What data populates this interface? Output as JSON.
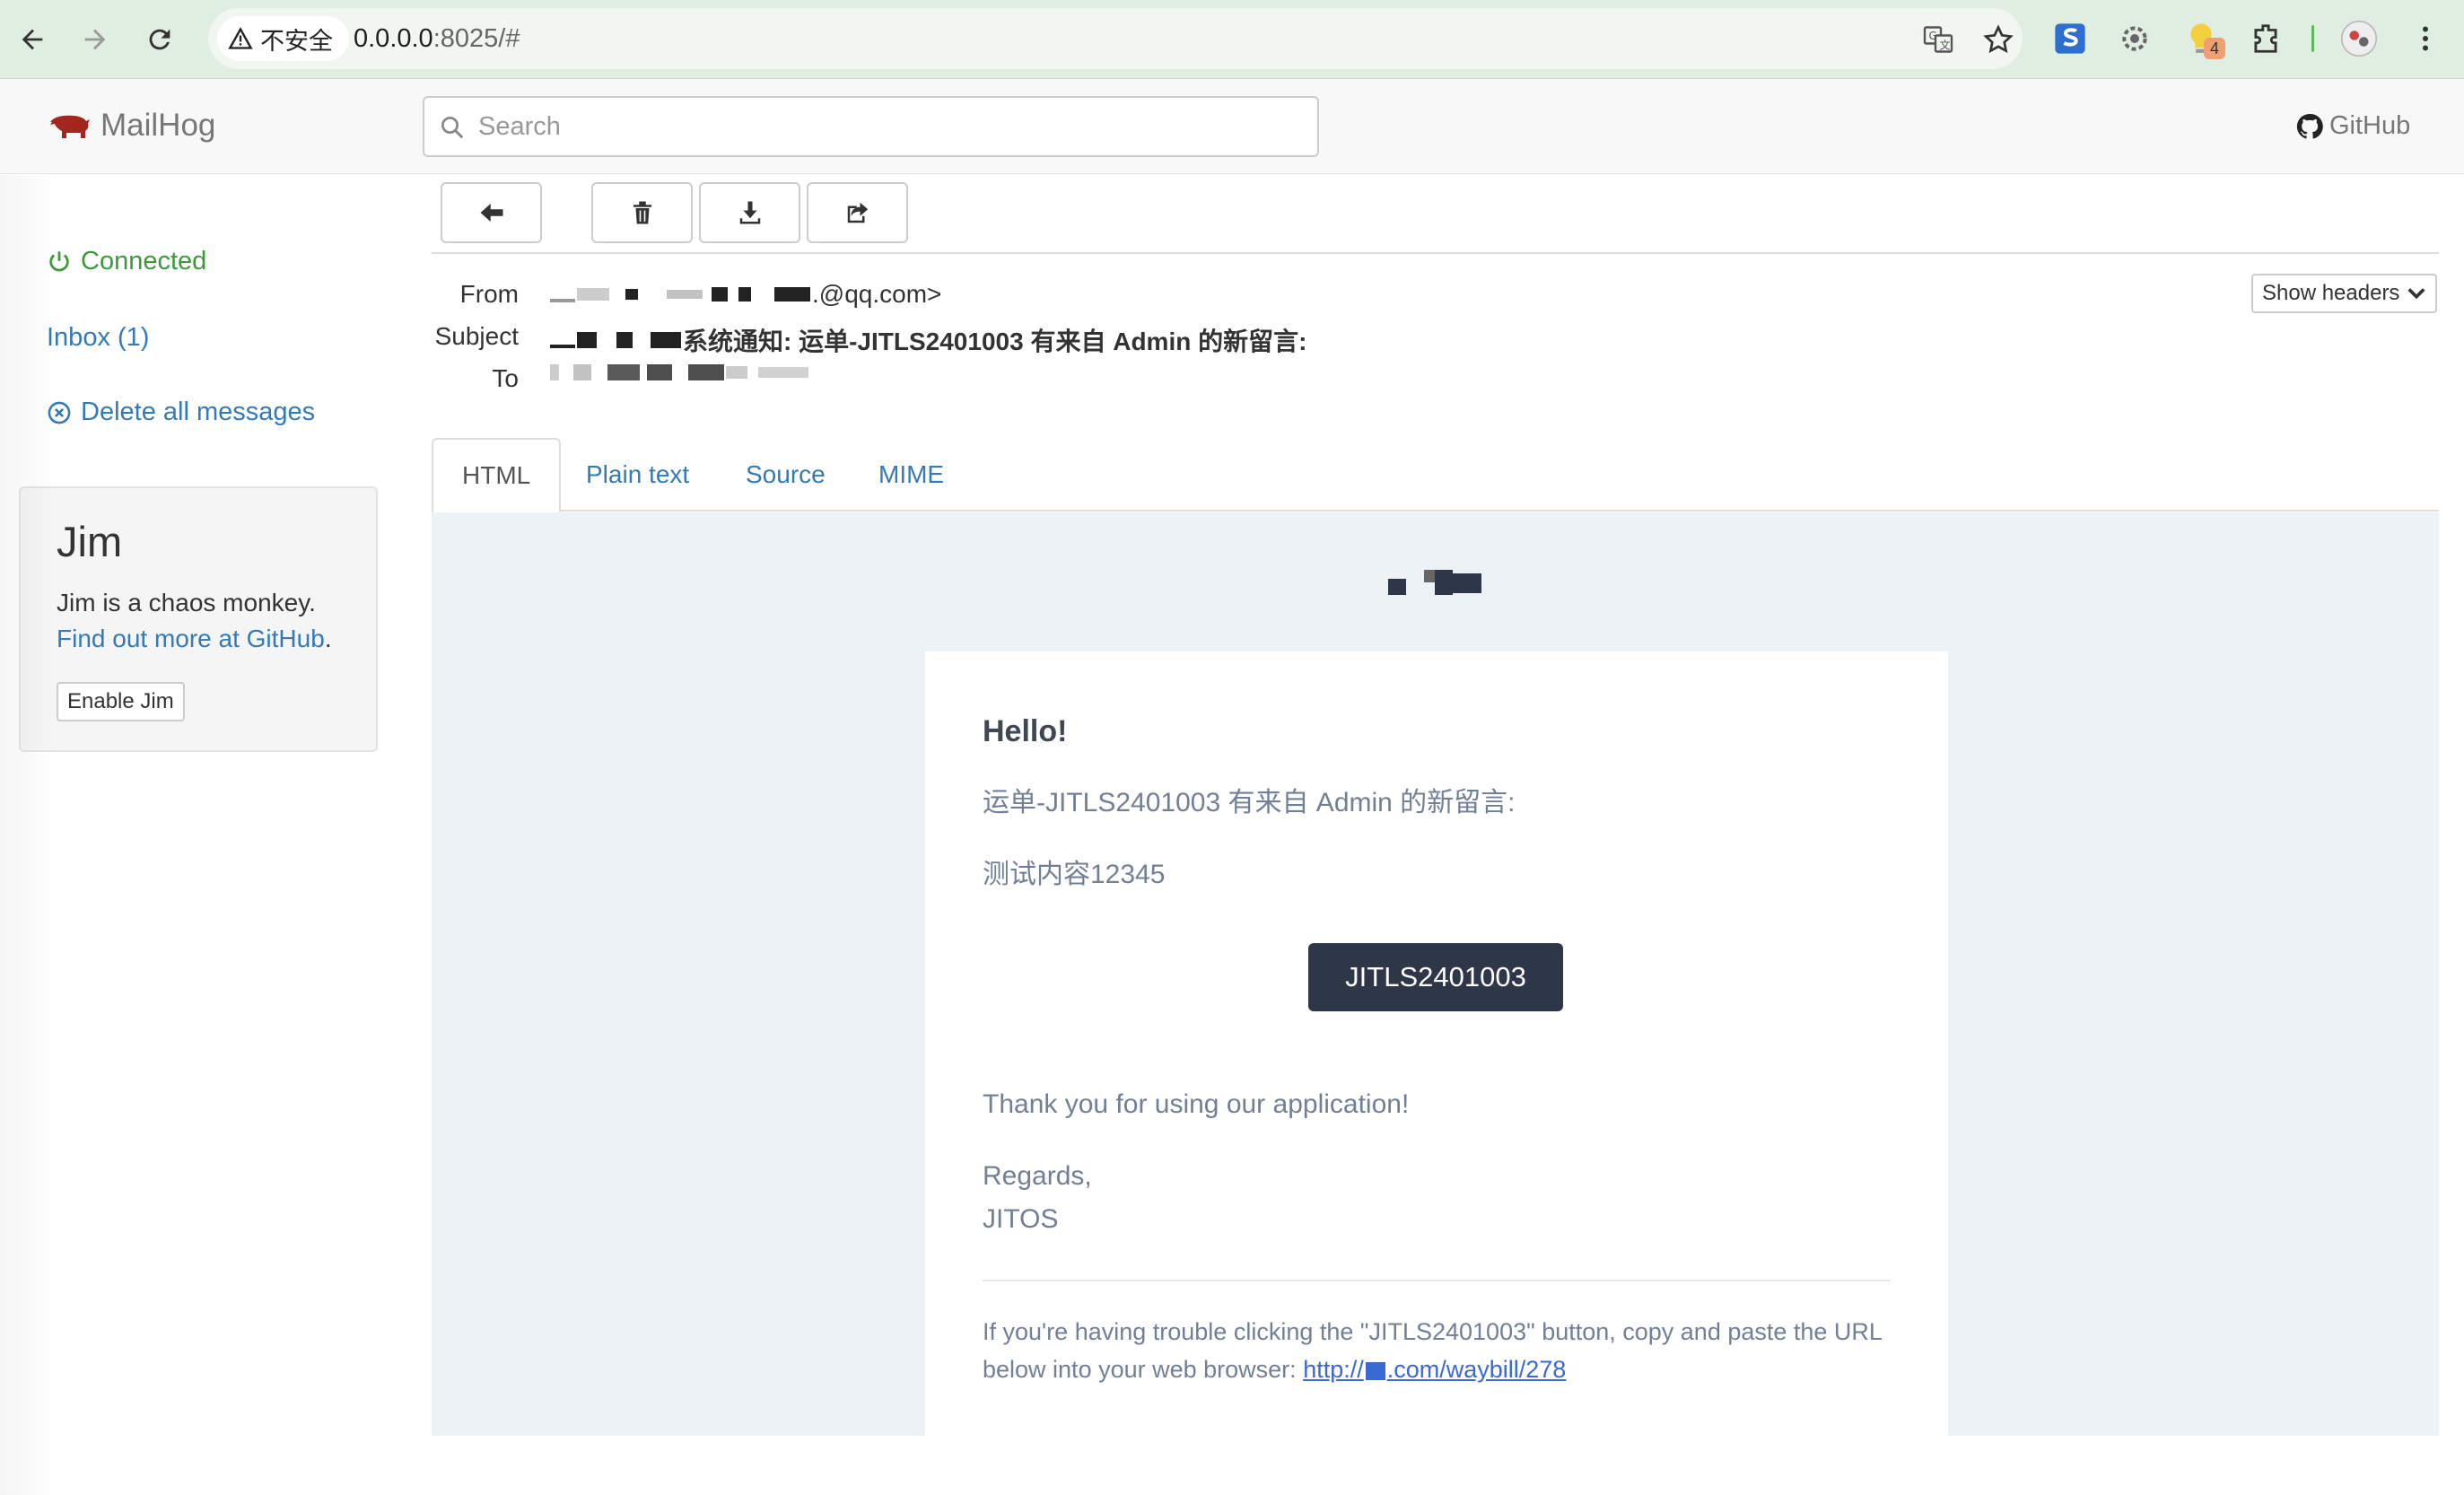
{
  "browser": {
    "security_label": "不安全",
    "url_host": "0.0.0.0",
    "url_rest": ":8025/#",
    "extension_badge": "4"
  },
  "app": {
    "brand": "MailHog",
    "search_placeholder": "Search",
    "github_label": "GitHub"
  },
  "sidebar": {
    "status": "Connected",
    "inbox": "Inbox (1)",
    "delete_all": "Delete all messages",
    "jim": {
      "title": "Jim",
      "description": "Jim is a chaos monkey.",
      "more_link": "Find out more at GitHub",
      "more_suffix": ".",
      "enable_button": "Enable Jim"
    }
  },
  "message": {
    "from_label": "From",
    "from_value": ".@qq.com>",
    "subject_label": "Subject",
    "subject_value": "系统通知: 运单-JITLS2401003 有来自 Admin 的新留言:",
    "to_label": "To",
    "show_headers": "Show headers"
  },
  "tabs": [
    "HTML",
    "Plain text",
    "Source",
    "MIME"
  ],
  "email": {
    "greeting": "Hello!",
    "line1": "运单-JITLS2401003 有来自 Admin 的新留言:",
    "line2": "测试内容12345",
    "button": "JITLS2401003",
    "thanks": "Thank you for using our application!",
    "regards": "Regards,",
    "signature": "JITOS",
    "subcopy_text": "If you're having trouble clicking the \"JITLS2401003\" button, copy and paste the URL below into your web browser:",
    "url_prefix": "http://",
    "url_suffix": ".com/waybill/278"
  },
  "colors": {
    "link": "#337ab7",
    "connected": "#3c9a3c",
    "email_bg": "#edf2f7",
    "button_bg": "#2d3748"
  }
}
